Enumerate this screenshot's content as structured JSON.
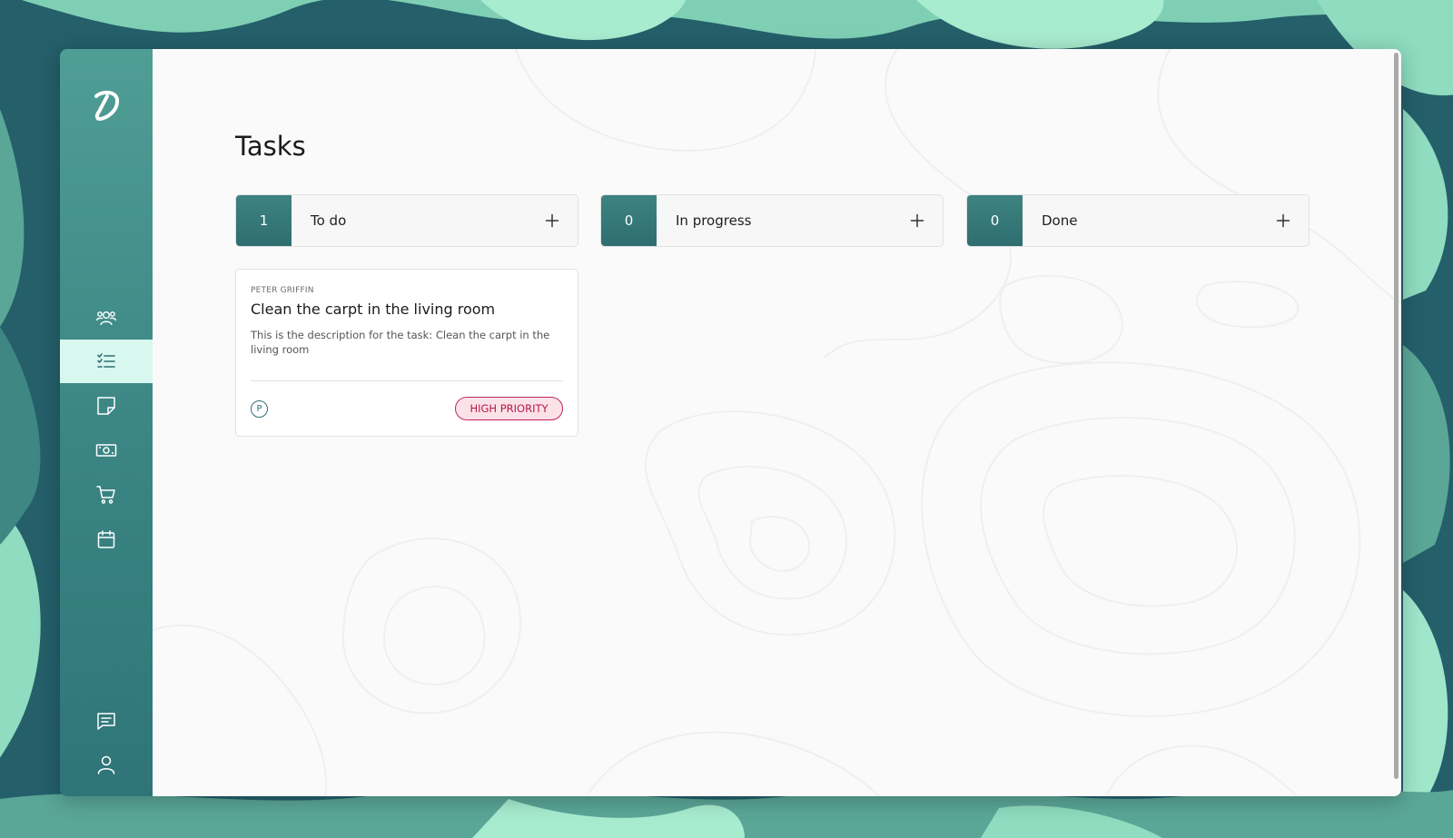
{
  "app": {
    "logo_alt": "app-logo",
    "colors": {
      "sidebar": "#3a8483",
      "active_nav": "#d8f7ee",
      "count_box": "#3e8381",
      "priority_border": "#c2265a",
      "priority_bg": "#fbe2e8"
    }
  },
  "sidebar": {
    "items": [
      {
        "icon": "users-icon",
        "active": false
      },
      {
        "icon": "task-list-icon",
        "active": true
      },
      {
        "icon": "sticky-note-icon",
        "active": false
      },
      {
        "icon": "money-icon",
        "active": false
      },
      {
        "icon": "cart-icon",
        "active": false
      },
      {
        "icon": "calendar-icon",
        "active": false
      },
      {
        "icon": "chat-icon",
        "active": false
      },
      {
        "icon": "user-icon",
        "active": false
      }
    ]
  },
  "main": {
    "title": "Tasks",
    "columns": [
      {
        "count": "1",
        "label": "To do",
        "add_icon": "plus-icon"
      },
      {
        "count": "0",
        "label": "In progress",
        "add_icon": "plus-icon"
      },
      {
        "count": "0",
        "label": "Done",
        "add_icon": "plus-icon"
      }
    ],
    "task": {
      "assignee": "PETER GRIFFIN",
      "title": "Clean the carpt in the living room",
      "description": "This is the description for the task: Clean the carpt in the living room",
      "avatar_initial": "P",
      "priority": "HIGH PRIORITY"
    }
  }
}
